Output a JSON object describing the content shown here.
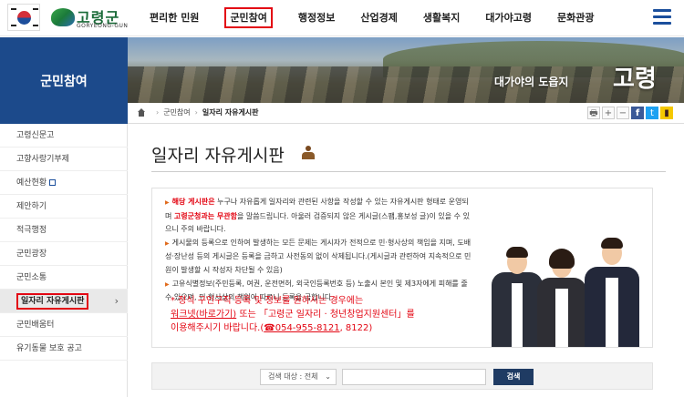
{
  "header": {
    "logo_name": "고령군",
    "logo_sub": "GORYEONG-GUN",
    "nav": [
      "편리한 민원",
      "군민참여",
      "행정정보",
      "산업경제",
      "생활복지",
      "대가야고령",
      "문화관광"
    ],
    "active_nav": "군민참여"
  },
  "banner": {
    "section_title": "군민참여",
    "slogan": "대가야의 도읍지",
    "slogan_big": "고령"
  },
  "breadcrumb": {
    "items": [
      "군민참여",
      "일자리 자유게시판"
    ]
  },
  "tools": {
    "print": "🖶",
    "plus": "+",
    "minus": "−",
    "facebook": "f",
    "twitter": "t",
    "kakaostory": "▮"
  },
  "sidebar": {
    "items": [
      {
        "label": "고령신문고"
      },
      {
        "label": "고향사랑기부제"
      },
      {
        "label": "예산현황"
      },
      {
        "label": "제안하기"
      },
      {
        "label": "적극행정"
      },
      {
        "label": "군민광장"
      },
      {
        "label": "군민소통"
      },
      {
        "label": "일자리 자유게시판"
      },
      {
        "label": "군민배움터"
      },
      {
        "label": "유기동물 보호 공고"
      }
    ],
    "active_index": 7,
    "chevron": "›"
  },
  "main": {
    "title": "일자리 자유게시판",
    "notice": {
      "p1_red": "해당 게시판은",
      "p1_a": " 누구나 자유롭게 일자리와 관련된 사항을 작성할 수 있는 자유게시판 형태로 운영되며 ",
      "p1_red2": "고령군청과는 무관함",
      "p1_b": "을 말씀드립니다. 아울러 검증되지 않은 게시글(스팸,홍보성 글)이 있을 수 있으니 주의 바랍니다.",
      "p2": "게시물의 등록으로 인하여 발생하는 모든 문제는 게시자가 전적으로 민·형사상의 책임을 지며, 도배성·장난성 등의 게시글은 등록을 금하고 사전동의 없이 삭제됩니다.(게시글과 관련하여 지속적으로 민원이 발생할 시 작성자 차단될 수 있음)",
      "p3": "고유식별정보(주민등록, 여권, 운전면허, 외국인등록번호 등) 노출시 본인 및 제3자에게 피해를 줄 수 있으며, 민·형사상의 책임이 따르니 등록을 금합니다.",
      "warn1": "* 정식 구인구직 등록 및 정보를 원하시는 경우에는",
      "warn2a": "워크넷(바로가기)",
      "warn2b": " 또는 「고령군 일자리 · 청년창업지원센터」를",
      "warn3a": "이용해주시기 바랍니다.(",
      "warn3phone": "☎054-955-8121",
      "warn3b": ", 8122)"
    },
    "search": {
      "select_label": "검색 대상 : 전체",
      "input_value": "",
      "button": "검색"
    }
  },
  "colors": {
    "accent_blue": "#1c4a8b",
    "highlight_red": "#e30613",
    "search_button": "#1f3b63"
  }
}
